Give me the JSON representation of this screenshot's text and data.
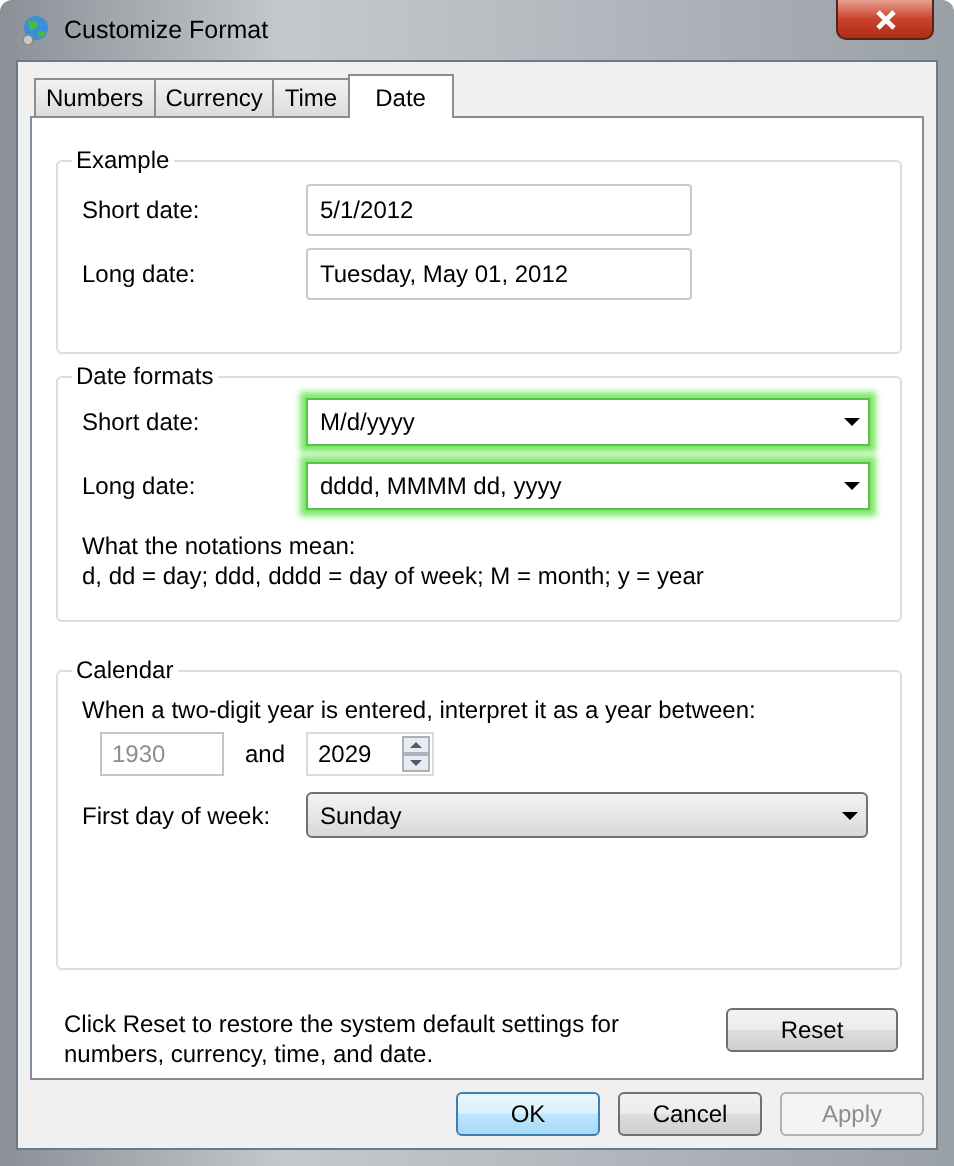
{
  "window": {
    "title": "Customize Format"
  },
  "tabs": [
    {
      "label": "Numbers",
      "selected": false
    },
    {
      "label": "Currency",
      "selected": false
    },
    {
      "label": "Time",
      "selected": false
    },
    {
      "label": "Date",
      "selected": true
    }
  ],
  "example": {
    "title": "Example",
    "fields": [
      {
        "label": "Short date:",
        "value": "5/1/2012"
      },
      {
        "label": "Long date:",
        "value": "Tuesday, May 01, 2012"
      }
    ]
  },
  "date_formats": {
    "title": "Date formats",
    "highlighted": true,
    "fields": [
      {
        "label": "Short date:",
        "value": "M/d/yyyy"
      },
      {
        "label": "Long date:",
        "value": "dddd, MMMM dd, yyyy"
      }
    ],
    "notation_title": "What the notations mean:",
    "notation_text": "d, dd = day;  ddd, dddd = day of week;  M = month;  y = year"
  },
  "calendar": {
    "title": "Calendar",
    "two_digit_label": "When a two-digit year is entered, interpret it as a year between:",
    "from": {
      "value": "1930",
      "disabled": true
    },
    "and": "and",
    "to": {
      "value": "2029",
      "disabled": false
    },
    "first_day_label": "First day of week:",
    "first_day": "Sunday"
  },
  "reset_note": "Click Reset to restore the system default settings for numbers, currency, time, and date.",
  "reset_button": "Reset",
  "buttons": [
    {
      "label": "OK",
      "kind": "default",
      "disabled": false
    },
    {
      "label": "Cancel",
      "kind": "normal",
      "disabled": false
    },
    {
      "label": "Apply",
      "kind": "normal",
      "disabled": true
    }
  ]
}
